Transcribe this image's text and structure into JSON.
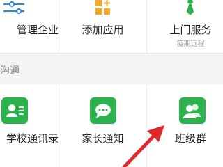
{
  "top_row": {
    "items": [
      {
        "label": "管理企业",
        "icon": "sliders-icon"
      },
      {
        "label": "添加应用",
        "icon": "add-app-icon"
      },
      {
        "label": "上门服务",
        "subtitle": "疫期远程",
        "icon": "tie-icon"
      }
    ]
  },
  "section": {
    "title": "沟通"
  },
  "apps": [
    {
      "label": "学校通讯录",
      "icon": "contact-card-icon"
    },
    {
      "label": "家长通知",
      "icon": "chat-bubble-icon"
    },
    {
      "label": "班级群",
      "icon": "group-icon"
    }
  ],
  "colors": {
    "accent_green": "#2bb24c",
    "orange": "#f5a623",
    "arrow_red": "#e0282c"
  }
}
